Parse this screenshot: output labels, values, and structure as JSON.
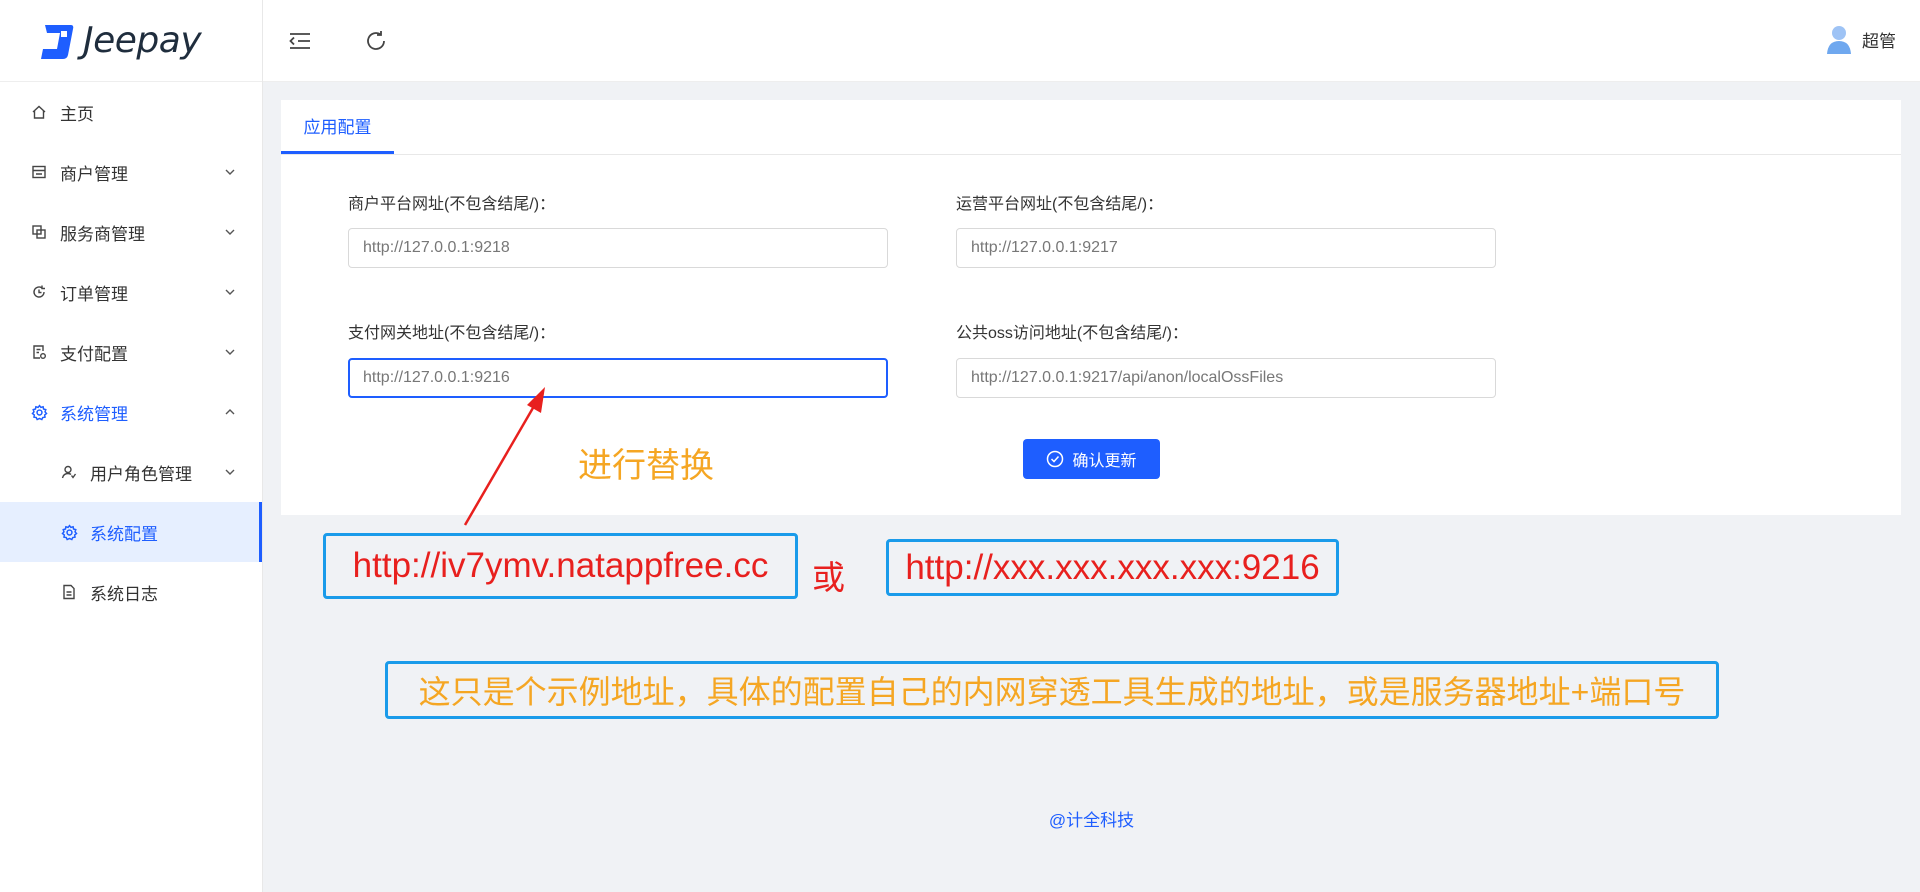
{
  "app": {
    "name": "Jeepay"
  },
  "sidebar": {
    "items": [
      {
        "label": "主页",
        "icon": "home-icon"
      },
      {
        "label": "商户管理",
        "icon": "store-icon"
      },
      {
        "label": "服务商管理",
        "icon": "partner-icon"
      },
      {
        "label": "订单管理",
        "icon": "order-icon"
      },
      {
        "label": "支付配置",
        "icon": "pay-config-icon"
      },
      {
        "label": "系统管理",
        "icon": "gear-icon"
      },
      {
        "label": "用户角色管理",
        "icon": "user-role-icon"
      },
      {
        "label": "系统配置",
        "icon": "gear-icon"
      },
      {
        "label": "系统日志",
        "icon": "log-icon"
      }
    ]
  },
  "header": {
    "user_name": "超管"
  },
  "tabs": [
    {
      "label": "应用配置"
    }
  ],
  "form": {
    "merchant_url": {
      "label": "商户平台网址(不包含结尾/)：",
      "value": "http://127.0.0.1:9218"
    },
    "mgr_url": {
      "label": "运营平台网址(不包含结尾/)：",
      "value": "http://127.0.0.1:9217"
    },
    "pay_url": {
      "label": "支付网关地址(不包含结尾/)：",
      "value": "http://127.0.0.1:9216"
    },
    "oss_url": {
      "label": "公共oss访问地址(不包含结尾/)：",
      "value": "http://127.0.0.1:9217/api/anon/localOssFiles"
    },
    "confirm_label": "确认更新"
  },
  "annotations": {
    "replace_text": "进行替换",
    "example_url_1": "http://iv7ymv.natappfree.cc",
    "or_text": "或",
    "example_url_2": "http://xxx.xxx.xxx.xxx:9216",
    "note": "这只是个示例地址，具体的配置自己的内网穿透工具生成的地址，或是服务器地址+端口号"
  },
  "footer": {
    "text": "@计全科技"
  },
  "colors": {
    "primary": "#1e5eff",
    "annotation_red": "#e8201e",
    "annotation_orange": "#f5a623",
    "annotation_box": "#1a9bea"
  }
}
